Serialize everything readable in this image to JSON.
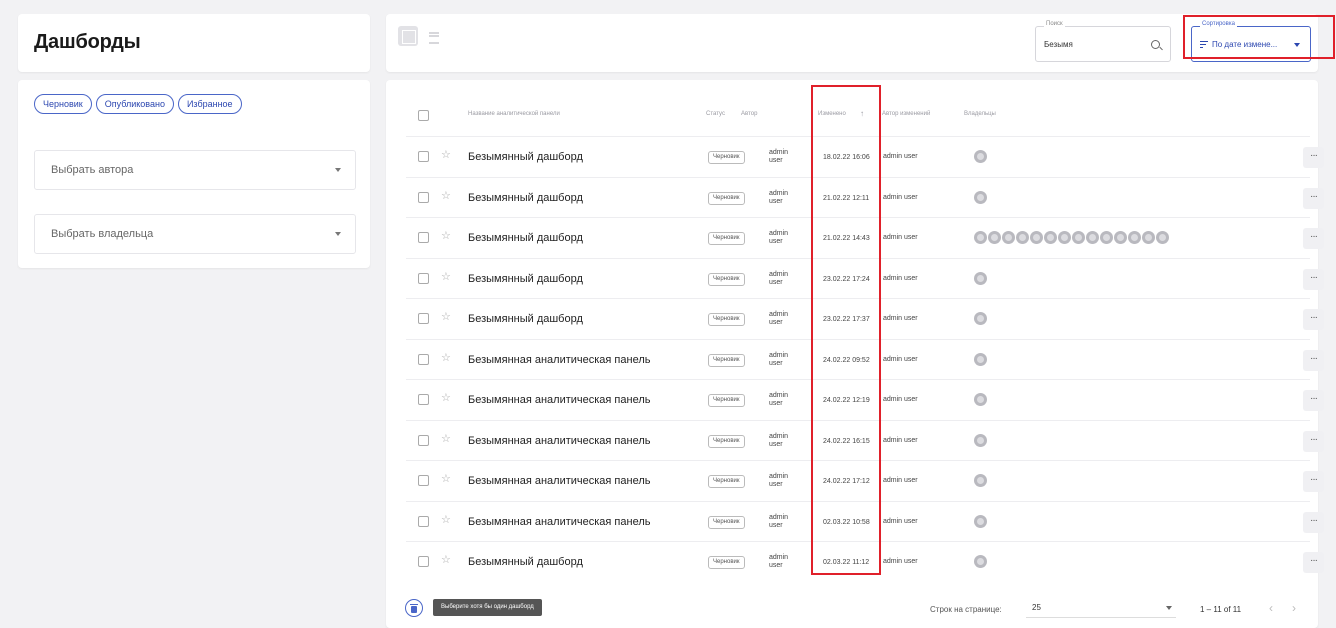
{
  "page": {
    "title": "Дашборды"
  },
  "filters": {
    "chips": [
      "Черновик",
      "Опубликовано",
      "Избранное"
    ],
    "author_select": "Выбрать автора",
    "owner_select": "Выбрать владельца"
  },
  "toolbar": {
    "search": {
      "label": "Поиск",
      "value": "Безымя"
    },
    "sort": {
      "label": "Сортировка",
      "value": "По дате измене..."
    }
  },
  "table": {
    "headers": {
      "name": "Название аналитической панели",
      "status": "Статус",
      "author": "Автор",
      "modified": "Изменено",
      "modified_by": "Автор изменений",
      "owners": "Владельцы"
    },
    "rows": [
      {
        "name": "Безымянный дашборд",
        "status": "Черновик",
        "author": "admin user",
        "modified": "18.02.22 16:06",
        "modified_by": "admin user",
        "owners": 1
      },
      {
        "name": "Безымянный дашборд",
        "status": "Черновик",
        "author": "admin user",
        "modified": "21.02.22 12:11",
        "modified_by": "admin user",
        "owners": 1
      },
      {
        "name": "Безымянный дашборд",
        "status": "Черновик",
        "author": "admin user",
        "modified": "21.02.22 14:43",
        "modified_by": "admin user",
        "owners": 14
      },
      {
        "name": "Безымянный дашборд",
        "status": "Черновик",
        "author": "admin user",
        "modified": "23.02.22 17:24",
        "modified_by": "admin user",
        "owners": 1
      },
      {
        "name": "Безымянный дашборд",
        "status": "Черновик",
        "author": "admin user",
        "modified": "23.02.22 17:37",
        "modified_by": "admin user",
        "owners": 1
      },
      {
        "name": "Безымянная аналитическая панель",
        "status": "Черновик",
        "author": "admin user",
        "modified": "24.02.22 09:52",
        "modified_by": "admin user",
        "owners": 1
      },
      {
        "name": "Безымянная аналитическая панель",
        "status": "Черновик",
        "author": "admin user",
        "modified": "24.02.22 12:19",
        "modified_by": "admin user",
        "owners": 1
      },
      {
        "name": "Безымянная аналитическая панель",
        "status": "Черновик",
        "author": "admin user",
        "modified": "24.02.22 16:15",
        "modified_by": "admin user",
        "owners": 1
      },
      {
        "name": "Безымянная аналитическая панель",
        "status": "Черновик",
        "author": "admin user",
        "modified": "24.02.22 17:12",
        "modified_by": "admin user",
        "owners": 1
      },
      {
        "name": "Безымянная аналитическая панель",
        "status": "Черновик",
        "author": "admin user",
        "modified": "02.03.22 10:58",
        "modified_by": "admin user",
        "owners": 1
      },
      {
        "name": "Безымянный дашборд",
        "status": "Черновик",
        "author": "admin user",
        "modified": "02.03.22 11:12",
        "modified_by": "admin user",
        "owners": 1
      }
    ],
    "more_label": "···"
  },
  "footer": {
    "delete_tooltip": "Выберите хотя бы один дашборд",
    "rows_per_page_label": "Строк на странице:",
    "rows_per_page_value": "25",
    "range": "1 – 11 of 11",
    "prev": "‹",
    "next": "›"
  },
  "colors": {
    "accent": "#4a66c8",
    "highlight": "#e0202a"
  },
  "icons": [
    "grid-view-icon",
    "list-view-icon",
    "search-icon",
    "sort-icon",
    "star-icon",
    "avatar-icon",
    "trash-icon",
    "chevron-left-icon",
    "chevron-right-icon"
  ]
}
